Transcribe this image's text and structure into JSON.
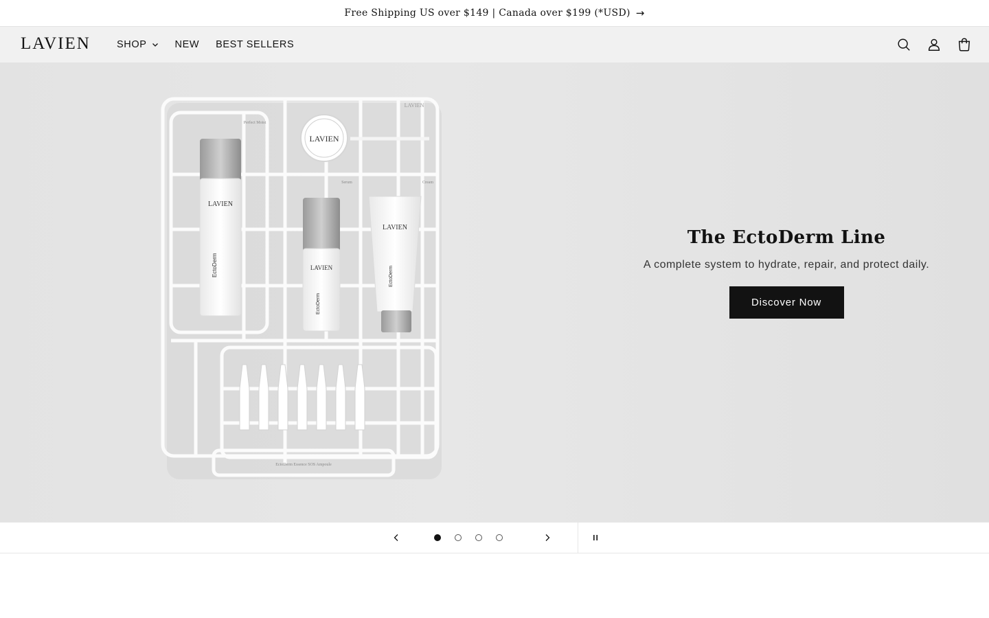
{
  "announcement": {
    "text": "Free Shipping US over $149 | Canada over $199 (*USD)",
    "arrow": "→"
  },
  "header": {
    "logo": "LAVIEN",
    "nav": [
      {
        "label": "SHOP",
        "has_dropdown": true
      },
      {
        "label": "NEW"
      },
      {
        "label": "BEST SELLERS"
      }
    ],
    "icons": [
      "search-icon",
      "account-icon",
      "cart-icon"
    ]
  },
  "hero": {
    "title": "The EctoDerm Line",
    "subtitle": "A complete system to hydrate, repair, and protect daily.",
    "cta": "Discover Now",
    "product_labels": {
      "brand": "LAVIEN",
      "line": "EctoDerm",
      "tag_serum": "Serum",
      "tag_cream": "Cream",
      "tag_mist": "Perfect Moist",
      "tray_caption": "EctoDerm Essence SOS Ampoule"
    }
  },
  "slider": {
    "prev_icon": "chevron-left-icon",
    "next_icon": "chevron-right-icon",
    "pause_icon": "pause-icon",
    "slide_count": 4,
    "active_index": 0
  },
  "colors": {
    "text": "#121212",
    "hero_bg": "#e3e3e3",
    "header_bg": "#f1f1f1",
    "button_bg": "#121212"
  }
}
